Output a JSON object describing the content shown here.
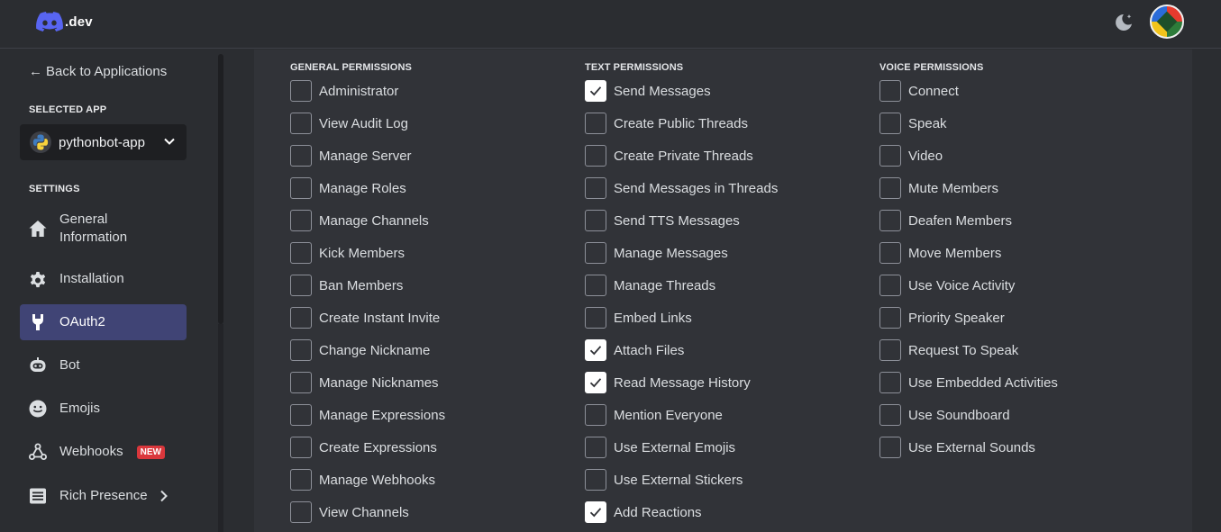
{
  "header": {
    "logo_text": ".dev",
    "theme_toggle_icon": "moon-star-icon",
    "avatar_icon": "user-avatar"
  },
  "sidebar": {
    "back_label": "Back to Applications",
    "selected_app_label": "SELECTED APP",
    "app_name": "pythonbot-app",
    "settings_label": "SETTINGS",
    "items": [
      {
        "label": "General Information",
        "icon": "home-icon",
        "active": false
      },
      {
        "label": "Installation",
        "icon": "gear-icon",
        "active": false
      },
      {
        "label": "OAuth2",
        "icon": "wrench-icon",
        "active": true
      },
      {
        "label": "Bot",
        "icon": "bot-icon",
        "active": false
      },
      {
        "label": "Emojis",
        "icon": "smiley-icon",
        "active": false
      },
      {
        "label": "Webhooks",
        "icon": "webhook-icon",
        "active": false,
        "badge": "NEW"
      },
      {
        "label": "Rich Presence",
        "icon": "document-icon",
        "active": false
      }
    ]
  },
  "permissions": {
    "general": {
      "title": "GENERAL PERMISSIONS",
      "items": [
        {
          "label": "Administrator",
          "checked": false
        },
        {
          "label": "View Audit Log",
          "checked": false
        },
        {
          "label": "Manage Server",
          "checked": false
        },
        {
          "label": "Manage Roles",
          "checked": false
        },
        {
          "label": "Manage Channels",
          "checked": false
        },
        {
          "label": "Kick Members",
          "checked": false
        },
        {
          "label": "Ban Members",
          "checked": false
        },
        {
          "label": "Create Instant Invite",
          "checked": false
        },
        {
          "label": "Change Nickname",
          "checked": false
        },
        {
          "label": "Manage Nicknames",
          "checked": false
        },
        {
          "label": "Manage Expressions",
          "checked": false
        },
        {
          "label": "Create Expressions",
          "checked": false
        },
        {
          "label": "Manage Webhooks",
          "checked": false
        },
        {
          "label": "View Channels",
          "checked": false
        }
      ]
    },
    "text": {
      "title": "TEXT PERMISSIONS",
      "items": [
        {
          "label": "Send Messages",
          "checked": true
        },
        {
          "label": "Create Public Threads",
          "checked": false
        },
        {
          "label": "Create Private Threads",
          "checked": false
        },
        {
          "label": "Send Messages in Threads",
          "checked": false
        },
        {
          "label": "Send TTS Messages",
          "checked": false
        },
        {
          "label": "Manage Messages",
          "checked": false
        },
        {
          "label": "Manage Threads",
          "checked": false
        },
        {
          "label": "Embed Links",
          "checked": false
        },
        {
          "label": "Attach Files",
          "checked": true
        },
        {
          "label": "Read Message History",
          "checked": true
        },
        {
          "label": "Mention Everyone",
          "checked": false
        },
        {
          "label": "Use External Emojis",
          "checked": false
        },
        {
          "label": "Use External Stickers",
          "checked": false
        },
        {
          "label": "Add Reactions",
          "checked": true
        }
      ]
    },
    "voice": {
      "title": "VOICE PERMISSIONS",
      "items": [
        {
          "label": "Connect",
          "checked": false
        },
        {
          "label": "Speak",
          "checked": false
        },
        {
          "label": "Video",
          "checked": false
        },
        {
          "label": "Mute Members",
          "checked": false
        },
        {
          "label": "Deafen Members",
          "checked": false
        },
        {
          "label": "Move Members",
          "checked": false
        },
        {
          "label": "Use Voice Activity",
          "checked": false
        },
        {
          "label": "Priority Speaker",
          "checked": false
        },
        {
          "label": "Request To Speak",
          "checked": false
        },
        {
          "label": "Use Embedded Activities",
          "checked": false
        },
        {
          "label": "Use Soundboard",
          "checked": false
        },
        {
          "label": "Use External Sounds",
          "checked": false
        }
      ]
    }
  }
}
